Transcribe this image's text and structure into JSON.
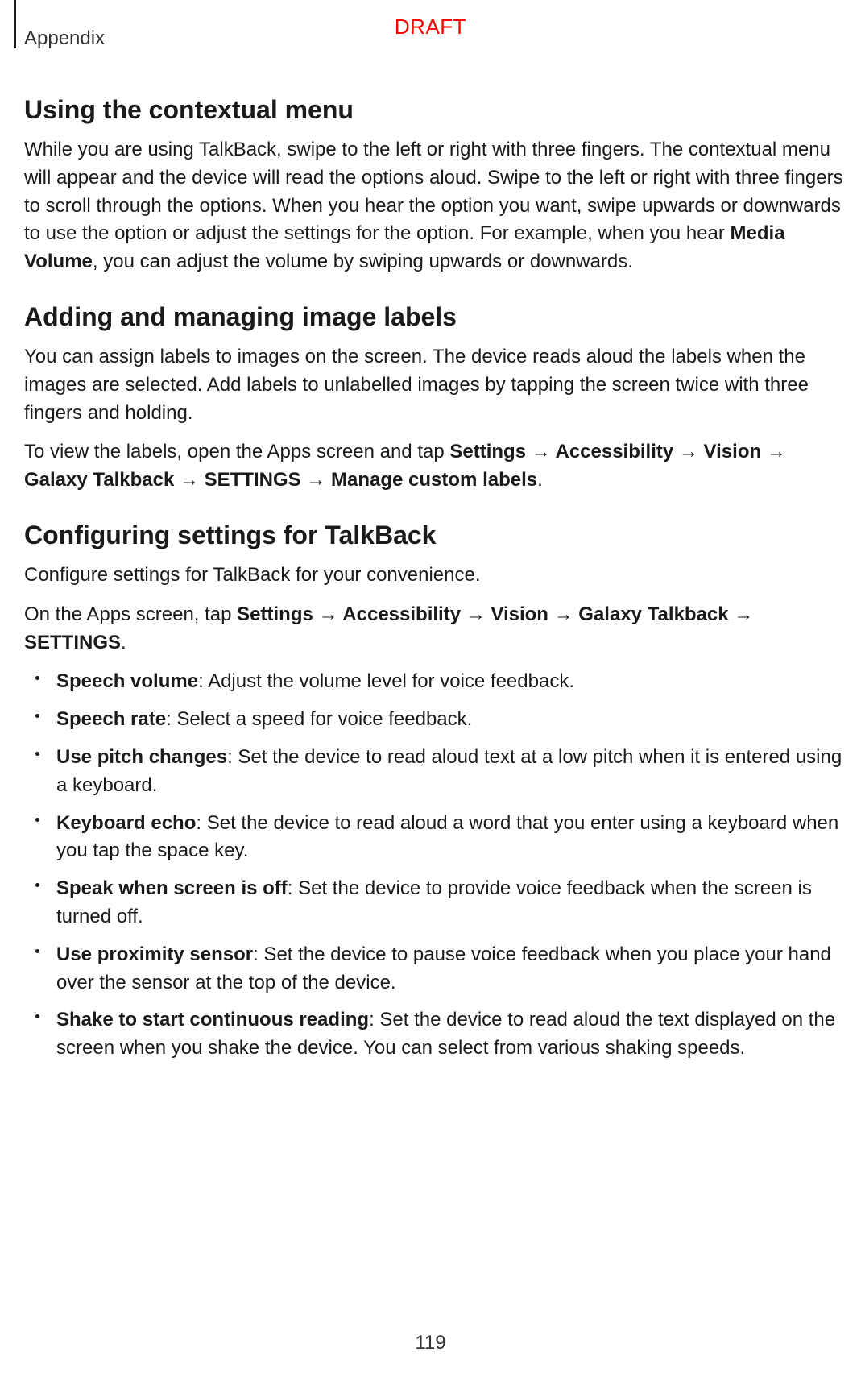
{
  "header": {
    "chapter": "Appendix",
    "watermark": "DRAFT"
  },
  "section1": {
    "title": "Using the contextual menu",
    "p1_a": "While you are using TalkBack, swipe to the left or right with three fingers. The contextual menu will appear and the device will read the options aloud. Swipe to the left or right with three fingers to scroll through the options. When you hear the option you want, swipe upwards or downwards to use the option or adjust the settings for the option. For example, when you hear ",
    "p1_b": "Media Volume",
    "p1_c": ", you can adjust the volume by swiping upwards or downwards."
  },
  "section2": {
    "title": "Adding and managing image labels",
    "p1": "You can assign labels to images on the screen. The device reads aloud the labels when the images are selected. Add labels to unlabelled images by tapping the screen twice with three fingers and holding.",
    "p2_a": "To view the labels, open the Apps screen and tap ",
    "p2_path": "Settings → Accessibility → Vision → Galaxy Talkback → SETTINGS → Manage custom labels",
    "p2_c": "."
  },
  "section3": {
    "title": "Configuring settings for TalkBack",
    "p1": "Configure settings for TalkBack for your convenience.",
    "p2_a": "On the Apps screen, tap ",
    "p2_path": "Settings → Accessibility → Vision → Galaxy Talkback → SETTINGS",
    "p2_c": ".",
    "items": [
      {
        "name": "Speech volume",
        "desc": ": Adjust the volume level for voice feedback."
      },
      {
        "name": "Speech rate",
        "desc": ": Select a speed for voice feedback."
      },
      {
        "name": "Use pitch changes",
        "desc": ": Set the device to read aloud text at a low pitch when it is entered using a keyboard."
      },
      {
        "name": "Keyboard echo",
        "desc": ": Set the device to read aloud a word that you enter using a keyboard when you tap the space key."
      },
      {
        "name": "Speak when screen is off",
        "desc": ": Set the device to provide voice feedback when the screen is turned off."
      },
      {
        "name": "Use proximity sensor",
        "desc": ": Set the device to pause voice feedback when you place your hand over the sensor at the top of the device."
      },
      {
        "name": "Shake to start continuous reading",
        "desc": ": Set the device to read aloud the text displayed on the screen when you shake the device. You can select from various shaking speeds."
      }
    ]
  },
  "page_number": "119"
}
